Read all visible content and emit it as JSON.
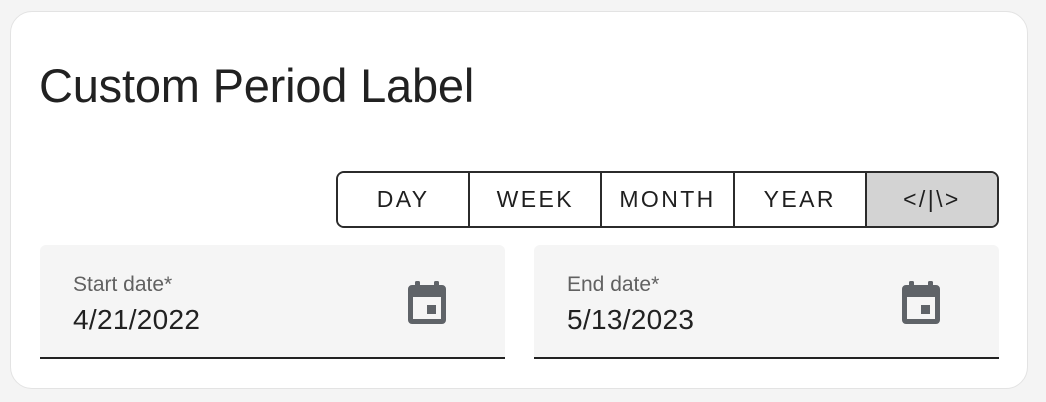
{
  "card": {
    "title": "Custom Period Label"
  },
  "period_selector": {
    "options": [
      {
        "label": "DAY",
        "selected": false
      },
      {
        "label": "WEEK",
        "selected": false
      },
      {
        "label": "MONTH",
        "selected": false
      },
      {
        "label": "YEAR",
        "selected": false
      },
      {
        "label": "</|\\>",
        "selected": true
      }
    ]
  },
  "start_date": {
    "label": "Start date*",
    "value": "4/21/2022",
    "icon": "calendar-icon"
  },
  "end_date": {
    "label": "End date*",
    "value": "5/13/2023",
    "icon": "calendar-icon"
  },
  "colors": {
    "card_background": "#ffffff",
    "page_background": "#f4f4f4",
    "selected_option": "#d3d3d3",
    "field_background": "#f5f5f5",
    "icon": "#5f6368",
    "text": "#212121"
  }
}
